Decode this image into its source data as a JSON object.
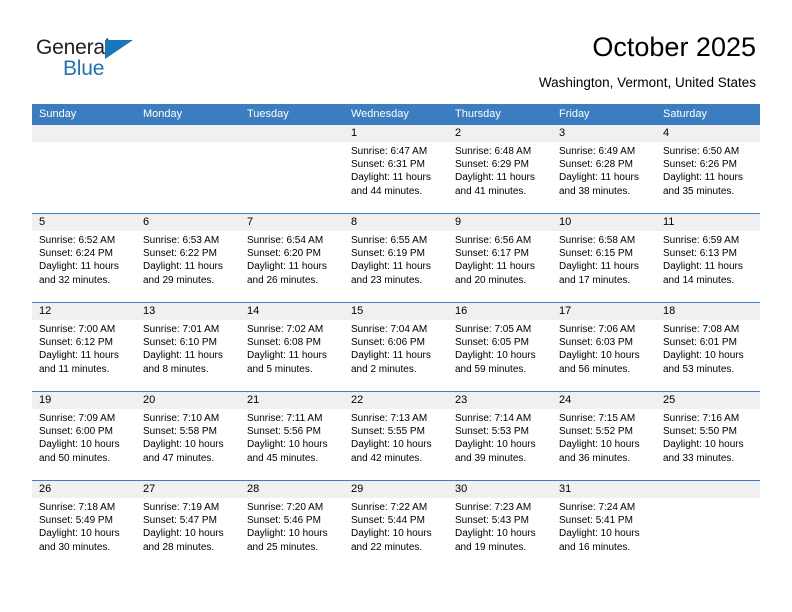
{
  "brand": {
    "name_line1": "General",
    "name_line2": "Blue",
    "accent_color": "#1b75bb"
  },
  "header": {
    "title": "October 2025",
    "subtitle": "Washington, Vermont, United States"
  },
  "calendar": {
    "header_bg": "#3b7dc0",
    "day_band_bg": "#f0f0f0",
    "weekdays": [
      "Sunday",
      "Monday",
      "Tuesday",
      "Wednesday",
      "Thursday",
      "Friday",
      "Saturday"
    ],
    "labels": {
      "sunrise": "Sunrise:",
      "sunset": "Sunset:",
      "daylight": "Daylight:"
    },
    "weeks": [
      [
        {
          "day": "",
          "empty": true
        },
        {
          "day": "",
          "empty": true
        },
        {
          "day": "",
          "empty": true
        },
        {
          "day": "1",
          "sunrise": "Sunrise: 6:47 AM",
          "sunset": "Sunset: 6:31 PM",
          "daylight_l1": "Daylight: 11 hours",
          "daylight_l2": "and 44 minutes."
        },
        {
          "day": "2",
          "sunrise": "Sunrise: 6:48 AM",
          "sunset": "Sunset: 6:29 PM",
          "daylight_l1": "Daylight: 11 hours",
          "daylight_l2": "and 41 minutes."
        },
        {
          "day": "3",
          "sunrise": "Sunrise: 6:49 AM",
          "sunset": "Sunset: 6:28 PM",
          "daylight_l1": "Daylight: 11 hours",
          "daylight_l2": "and 38 minutes."
        },
        {
          "day": "4",
          "sunrise": "Sunrise: 6:50 AM",
          "sunset": "Sunset: 6:26 PM",
          "daylight_l1": "Daylight: 11 hours",
          "daylight_l2": "and 35 minutes."
        }
      ],
      [
        {
          "day": "5",
          "sunrise": "Sunrise: 6:52 AM",
          "sunset": "Sunset: 6:24 PM",
          "daylight_l1": "Daylight: 11 hours",
          "daylight_l2": "and 32 minutes."
        },
        {
          "day": "6",
          "sunrise": "Sunrise: 6:53 AM",
          "sunset": "Sunset: 6:22 PM",
          "daylight_l1": "Daylight: 11 hours",
          "daylight_l2": "and 29 minutes."
        },
        {
          "day": "7",
          "sunrise": "Sunrise: 6:54 AM",
          "sunset": "Sunset: 6:20 PM",
          "daylight_l1": "Daylight: 11 hours",
          "daylight_l2": "and 26 minutes."
        },
        {
          "day": "8",
          "sunrise": "Sunrise: 6:55 AM",
          "sunset": "Sunset: 6:19 PM",
          "daylight_l1": "Daylight: 11 hours",
          "daylight_l2": "and 23 minutes."
        },
        {
          "day": "9",
          "sunrise": "Sunrise: 6:56 AM",
          "sunset": "Sunset: 6:17 PM",
          "daylight_l1": "Daylight: 11 hours",
          "daylight_l2": "and 20 minutes."
        },
        {
          "day": "10",
          "sunrise": "Sunrise: 6:58 AM",
          "sunset": "Sunset: 6:15 PM",
          "daylight_l1": "Daylight: 11 hours",
          "daylight_l2": "and 17 minutes."
        },
        {
          "day": "11",
          "sunrise": "Sunrise: 6:59 AM",
          "sunset": "Sunset: 6:13 PM",
          "daylight_l1": "Daylight: 11 hours",
          "daylight_l2": "and 14 minutes."
        }
      ],
      [
        {
          "day": "12",
          "sunrise": "Sunrise: 7:00 AM",
          "sunset": "Sunset: 6:12 PM",
          "daylight_l1": "Daylight: 11 hours",
          "daylight_l2": "and 11 minutes."
        },
        {
          "day": "13",
          "sunrise": "Sunrise: 7:01 AM",
          "sunset": "Sunset: 6:10 PM",
          "daylight_l1": "Daylight: 11 hours",
          "daylight_l2": "and 8 minutes."
        },
        {
          "day": "14",
          "sunrise": "Sunrise: 7:02 AM",
          "sunset": "Sunset: 6:08 PM",
          "daylight_l1": "Daylight: 11 hours",
          "daylight_l2": "and 5 minutes."
        },
        {
          "day": "15",
          "sunrise": "Sunrise: 7:04 AM",
          "sunset": "Sunset: 6:06 PM",
          "daylight_l1": "Daylight: 11 hours",
          "daylight_l2": "and 2 minutes."
        },
        {
          "day": "16",
          "sunrise": "Sunrise: 7:05 AM",
          "sunset": "Sunset: 6:05 PM",
          "daylight_l1": "Daylight: 10 hours",
          "daylight_l2": "and 59 minutes."
        },
        {
          "day": "17",
          "sunrise": "Sunrise: 7:06 AM",
          "sunset": "Sunset: 6:03 PM",
          "daylight_l1": "Daylight: 10 hours",
          "daylight_l2": "and 56 minutes."
        },
        {
          "day": "18",
          "sunrise": "Sunrise: 7:08 AM",
          "sunset": "Sunset: 6:01 PM",
          "daylight_l1": "Daylight: 10 hours",
          "daylight_l2": "and 53 minutes."
        }
      ],
      [
        {
          "day": "19",
          "sunrise": "Sunrise: 7:09 AM",
          "sunset": "Sunset: 6:00 PM",
          "daylight_l1": "Daylight: 10 hours",
          "daylight_l2": "and 50 minutes."
        },
        {
          "day": "20",
          "sunrise": "Sunrise: 7:10 AM",
          "sunset": "Sunset: 5:58 PM",
          "daylight_l1": "Daylight: 10 hours",
          "daylight_l2": "and 47 minutes."
        },
        {
          "day": "21",
          "sunrise": "Sunrise: 7:11 AM",
          "sunset": "Sunset: 5:56 PM",
          "daylight_l1": "Daylight: 10 hours",
          "daylight_l2": "and 45 minutes."
        },
        {
          "day": "22",
          "sunrise": "Sunrise: 7:13 AM",
          "sunset": "Sunset: 5:55 PM",
          "daylight_l1": "Daylight: 10 hours",
          "daylight_l2": "and 42 minutes."
        },
        {
          "day": "23",
          "sunrise": "Sunrise: 7:14 AM",
          "sunset": "Sunset: 5:53 PM",
          "daylight_l1": "Daylight: 10 hours",
          "daylight_l2": "and 39 minutes."
        },
        {
          "day": "24",
          "sunrise": "Sunrise: 7:15 AM",
          "sunset": "Sunset: 5:52 PM",
          "daylight_l1": "Daylight: 10 hours",
          "daylight_l2": "and 36 minutes."
        },
        {
          "day": "25",
          "sunrise": "Sunrise: 7:16 AM",
          "sunset": "Sunset: 5:50 PM",
          "daylight_l1": "Daylight: 10 hours",
          "daylight_l2": "and 33 minutes."
        }
      ],
      [
        {
          "day": "26",
          "sunrise": "Sunrise: 7:18 AM",
          "sunset": "Sunset: 5:49 PM",
          "daylight_l1": "Daylight: 10 hours",
          "daylight_l2": "and 30 minutes."
        },
        {
          "day": "27",
          "sunrise": "Sunrise: 7:19 AM",
          "sunset": "Sunset: 5:47 PM",
          "daylight_l1": "Daylight: 10 hours",
          "daylight_l2": "and 28 minutes."
        },
        {
          "day": "28",
          "sunrise": "Sunrise: 7:20 AM",
          "sunset": "Sunset: 5:46 PM",
          "daylight_l1": "Daylight: 10 hours",
          "daylight_l2": "and 25 minutes."
        },
        {
          "day": "29",
          "sunrise": "Sunrise: 7:22 AM",
          "sunset": "Sunset: 5:44 PM",
          "daylight_l1": "Daylight: 10 hours",
          "daylight_l2": "and 22 minutes."
        },
        {
          "day": "30",
          "sunrise": "Sunrise: 7:23 AM",
          "sunset": "Sunset: 5:43 PM",
          "daylight_l1": "Daylight: 10 hours",
          "daylight_l2": "and 19 minutes."
        },
        {
          "day": "31",
          "sunrise": "Sunrise: 7:24 AM",
          "sunset": "Sunset: 5:41 PM",
          "daylight_l1": "Daylight: 10 hours",
          "daylight_l2": "and 16 minutes."
        },
        {
          "day": "",
          "empty": true
        }
      ]
    ]
  }
}
